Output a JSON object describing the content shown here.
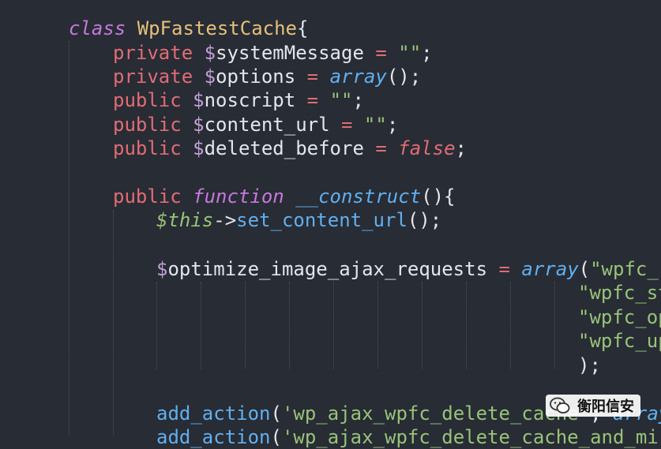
{
  "code": {
    "l1": {
      "kw": "class",
      "name": "WpFastestCache",
      "brace": "{"
    },
    "l2": {
      "mod": "private",
      "sign": "$",
      "var": "systemMessage",
      "eq": "=",
      "val": "\"\"",
      "end": ";"
    },
    "l3": {
      "mod": "private",
      "sign": "$",
      "var": "options",
      "eq": "=",
      "fn": "array",
      "rest": "();"
    },
    "l4": {
      "mod": "public",
      "sign": "$",
      "var": "noscript",
      "eq": "=",
      "val": "\"\"",
      "end": ";"
    },
    "l5": {
      "mod": "public",
      "sign": "$",
      "var": "content_url",
      "eq": "=",
      "val": "\"\"",
      "end": ";"
    },
    "l6": {
      "mod": "public",
      "sign": "$",
      "var": "deleted_before",
      "eq": "=",
      "val": "false",
      "end": ";"
    },
    "l8": {
      "mod": "public",
      "kw": "function",
      "name": "__construct",
      "rest": "(){"
    },
    "l9": {
      "this": "$this",
      "arrow": "->",
      "fn": "set_content_url",
      "rest": "();"
    },
    "l11": {
      "sign": "$",
      "var": "optimize_image_ajax_requests",
      "eq": "=",
      "fn": "array",
      "paren": "(",
      "val": "\"wpfc_re"
    },
    "l12": {
      "val": "\"wpfc_st"
    },
    "l13": {
      "val": "\"wpfc_op"
    },
    "l14": {
      "val": "\"wpfc_up"
    },
    "l15": {
      "rest": ");"
    },
    "l17": {
      "fn": "add_action",
      "paren": "(",
      "val": "'wp_ajax_wpfc_delete_cache'",
      "comma": ",",
      "fn2": "array",
      "paren2": "("
    },
    "l18": {
      "fn": "add_action",
      "paren": "(",
      "val": "'wp_ajax_wpfc_delete_cache_and_mi"
    }
  },
  "watermark": {
    "text": "衡阳信安",
    "icon": "wechat-icon"
  },
  "colors": {
    "background": "#282c34",
    "keyword_red": "#e06c75",
    "keyword_purple": "#c678dd",
    "class_name": "#e5c07b",
    "string": "#98c379",
    "function": "#61afef",
    "text": "#e3e6ec"
  }
}
